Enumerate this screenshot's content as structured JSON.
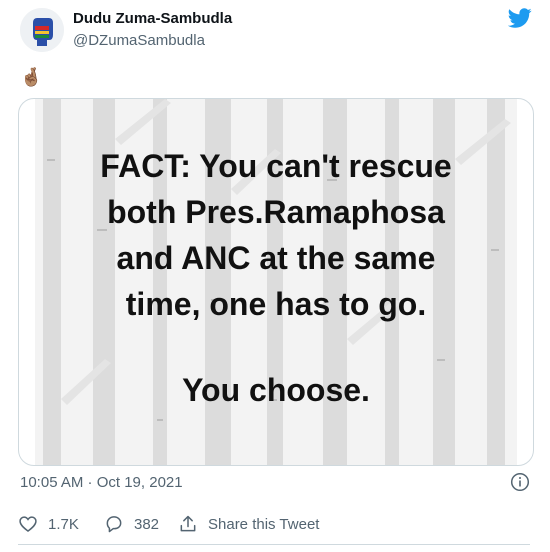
{
  "tweet": {
    "author_name": "Dudu Zuma-Sambudla",
    "author_handle": "@DZumaSambudla",
    "body_emoji": "🤞🏽",
    "image_text": {
      "lines": [
        "FACT: You can't rescue",
        "both Pres.Ramaphosa",
        "and ANC at the same",
        "time, one has to go."
      ],
      "choose": "You choose."
    },
    "timestamp": "10:05 AM · Oct 19, 2021"
  },
  "actions": {
    "likes": "1.7K",
    "replies": "382",
    "share_label": "Share this Tweet"
  },
  "icons": {
    "brand": "twitter-bird-icon",
    "info": "info-icon",
    "like": "heart-icon",
    "reply": "reply-icon",
    "share": "share-icon"
  },
  "colors": {
    "twitter_blue": "#1d9bf0",
    "muted": "#536471",
    "border": "#cfd9de"
  }
}
